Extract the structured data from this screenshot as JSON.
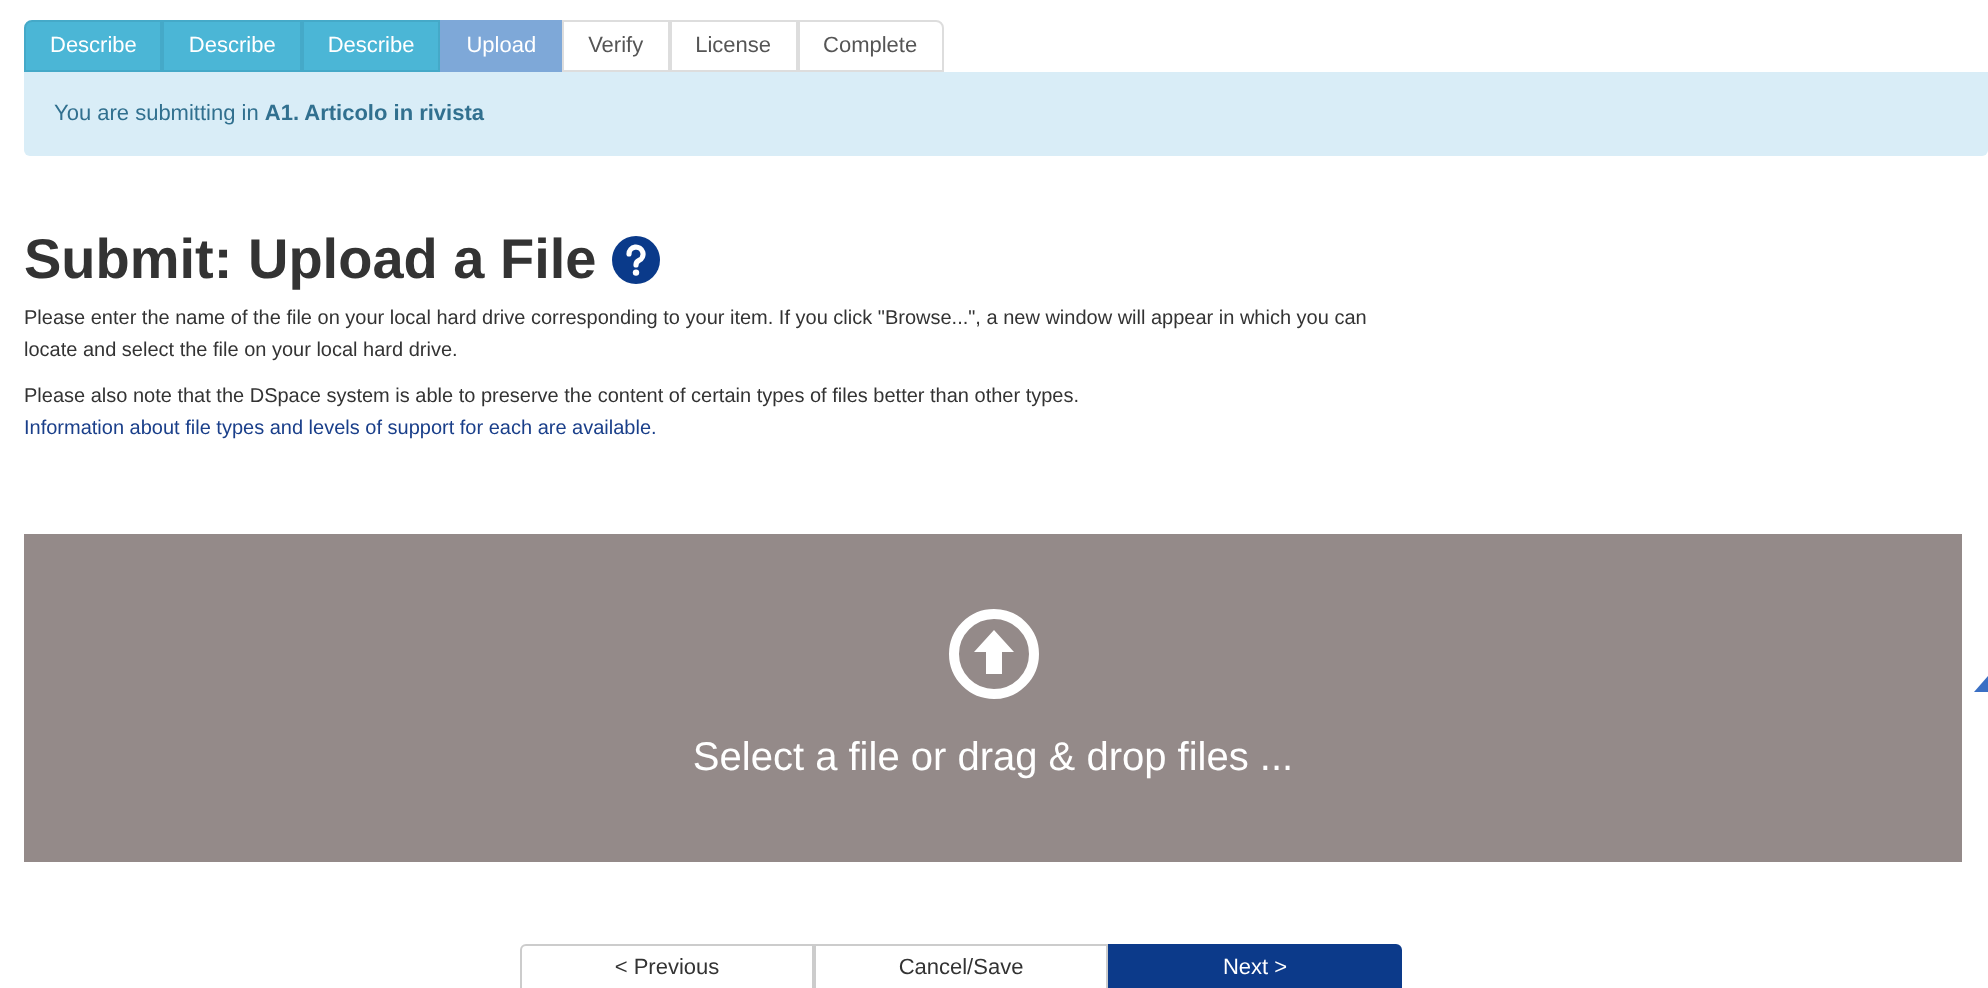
{
  "steps": [
    {
      "label": "Describe",
      "completed": true,
      "selected": false
    },
    {
      "label": "Describe",
      "completed": true,
      "selected": false
    },
    {
      "label": "Describe",
      "completed": true,
      "selected": false
    },
    {
      "label": "Upload",
      "completed": false,
      "selected": true
    },
    {
      "label": "Verify",
      "completed": false,
      "selected": false
    },
    {
      "label": "License",
      "completed": false,
      "selected": false
    },
    {
      "label": "Complete",
      "completed": false,
      "selected": false
    }
  ],
  "notice": "You are submitting in **A1. Articolo in rivista**",
  "title": "Submit: Upload a File",
  "paragraphs": [
    {
      "text": "Please enter the name of the file on your local hard drive corresponding to your item. If you click \"Browse...\", a new window will appear in which you can locate and select the file on your local hard drive."
    },
    {
      "text": "Please also note that the DSpace system is able to preserve the content of certain types of files better than other types.",
      "link": "Information about file types and levels of support for each are available."
    }
  ],
  "dropzone": {
    "label": "Select a file or drag & drop files ..."
  },
  "buttons": [
    {
      "label": "< Previous",
      "primary": false
    },
    {
      "label": "Cancel/Save",
      "primary": false
    },
    {
      "label": "Next >",
      "primary": true
    }
  ]
}
